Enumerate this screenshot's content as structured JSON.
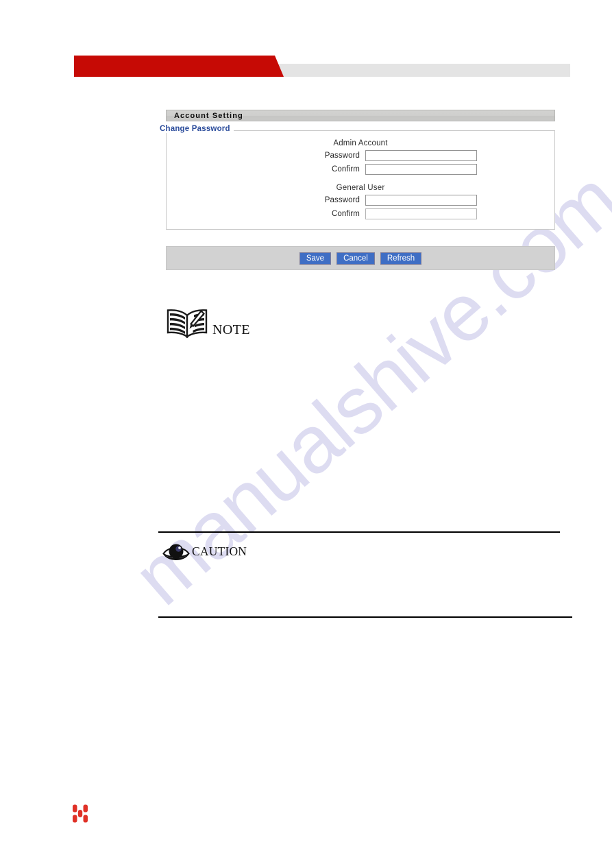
{
  "watermark": {
    "text": "manualshive.com",
    "color": "#c9c7ea"
  },
  "header": {
    "accent_color": "#c60a05",
    "bar_color": "#e4e4e4"
  },
  "panel": {
    "title": "Account Setting",
    "legend": "Change Password",
    "groups": [
      {
        "name": "Admin Account",
        "fields": [
          {
            "label": "Password",
            "value": "",
            "placeholder": ""
          },
          {
            "label": "Confirm",
            "value": "",
            "placeholder": ""
          }
        ]
      },
      {
        "name": "General User",
        "fields": [
          {
            "label": "Password",
            "value": "",
            "placeholder": ""
          },
          {
            "label": "Confirm",
            "value": "",
            "placeholder": ""
          }
        ]
      }
    ]
  },
  "buttons": {
    "save": "Save",
    "cancel": "Cancel",
    "refresh": "Refresh",
    "color": "#3f6ec4"
  },
  "admonitions": {
    "note": {
      "label": "NOTE",
      "icon": "open-book-pen-icon"
    },
    "caution": {
      "label": "CAUTION",
      "icon": "eye-icon"
    }
  },
  "footer": {
    "logo": "h-mark-logo",
    "logo_color": "#e03127"
  }
}
